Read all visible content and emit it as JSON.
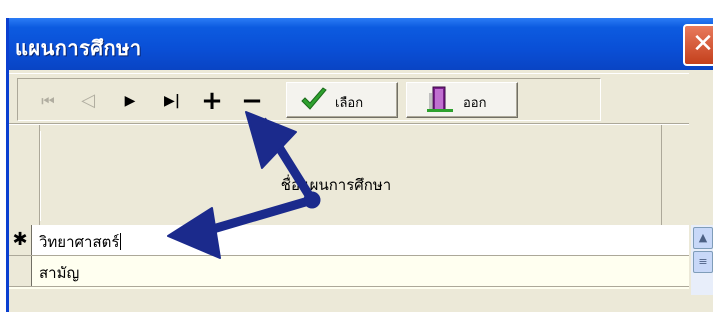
{
  "window": {
    "title": "แผนการศึกษา",
    "close_label": "✕"
  },
  "toolbar": {
    "nav_first": "⏮",
    "nav_prev": "◁",
    "nav_next": "▶",
    "nav_last": "▶|",
    "nav_add": "+",
    "nav_delete": "−",
    "select_label": "เลือก",
    "exit_label": "ออก"
  },
  "grid": {
    "column_header": "ชื่อแผนการศึกษา",
    "rows": [
      {
        "marker": "✱",
        "value": "วิทยาศาสตร์"
      },
      {
        "marker": "",
        "value": "สามัญ"
      }
    ]
  },
  "colors": {
    "titlebar": "#0a4fd6",
    "window_bg": "#ece9d8",
    "arrow": "#1b2a8c",
    "check": "#2ea12e"
  }
}
